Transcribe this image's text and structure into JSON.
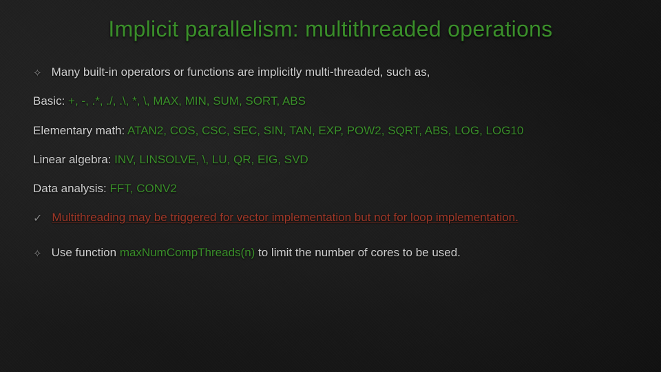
{
  "title": "Implicit parallelism: multithreaded operations",
  "intro": "Many built-in operators or functions are implicitly multi-threaded, such as,",
  "basic": {
    "label": "Basic: ",
    "ops": "+,   -,   .*,   ./,   .\\,   *,   \\, MAX, MIN, SUM, SORT, ABS"
  },
  "elem": {
    "label": "Elementary math: ",
    "ops": "ATAN2, COS, CSC, SEC, SIN, TAN, EXP, POW2, SQRT, ABS, LOG, LOG10"
  },
  "linalg": {
    "label": "Linear algebra: ",
    "ops": "INV, LINSOLVE, \\, LU, QR, EIG, SVD"
  },
  "data": {
    "label": "Data analysis:  ",
    "ops": "FFT, CONV2"
  },
  "note": "Multithreading may be triggered for vector implementation but not for loop implementation.",
  "hint_pre": "Use function ",
  "hint_fn": "maxNumCompThreads(n)",
  "hint_post": " to limit the number of cores to be used."
}
